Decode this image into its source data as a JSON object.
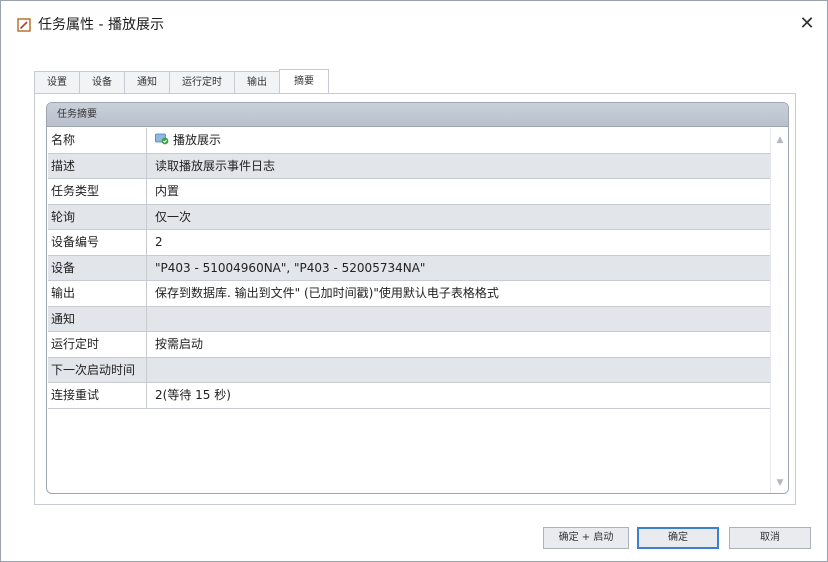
{
  "window": {
    "title": "任务属性 - 播放展示",
    "close_glyph": "✕"
  },
  "tabs": [
    {
      "label": "设置"
    },
    {
      "label": "设备"
    },
    {
      "label": "通知"
    },
    {
      "label": "运行定时"
    },
    {
      "label": "输出"
    },
    {
      "label": "摘要"
    }
  ],
  "active_tab": "摘要",
  "summary": {
    "header": "任务摘要",
    "rows": [
      {
        "key": "名称",
        "value": "播放展示"
      },
      {
        "key": "描述",
        "value": "读取播放展示事件日志"
      },
      {
        "key": "任务类型",
        "value": "内置"
      },
      {
        "key": "轮询",
        "value": "仅一次"
      },
      {
        "key": "设备编号",
        "value": "2"
      },
      {
        "key": "设备",
        "value": "\"P403 - 51004960NA\", \"P403 - 52005734NA\""
      },
      {
        "key": "输出",
        "value": "保存到数据库. 输出到文件\" (已加时间戳)\"使用默认电子表格格式"
      },
      {
        "key": "通知",
        "value": ""
      },
      {
        "key": "运行定时",
        "value": "按需启动"
      },
      {
        "key": "下一次启动时间",
        "value": ""
      },
      {
        "key": "连接重试",
        "value": "2(等待 15 秒)"
      }
    ]
  },
  "buttons": {
    "ok_start": "确定 + 启动",
    "ok": "确定",
    "cancel": "取消"
  },
  "icons": {
    "title": "edit-document-icon",
    "name_row": "task-icon"
  }
}
